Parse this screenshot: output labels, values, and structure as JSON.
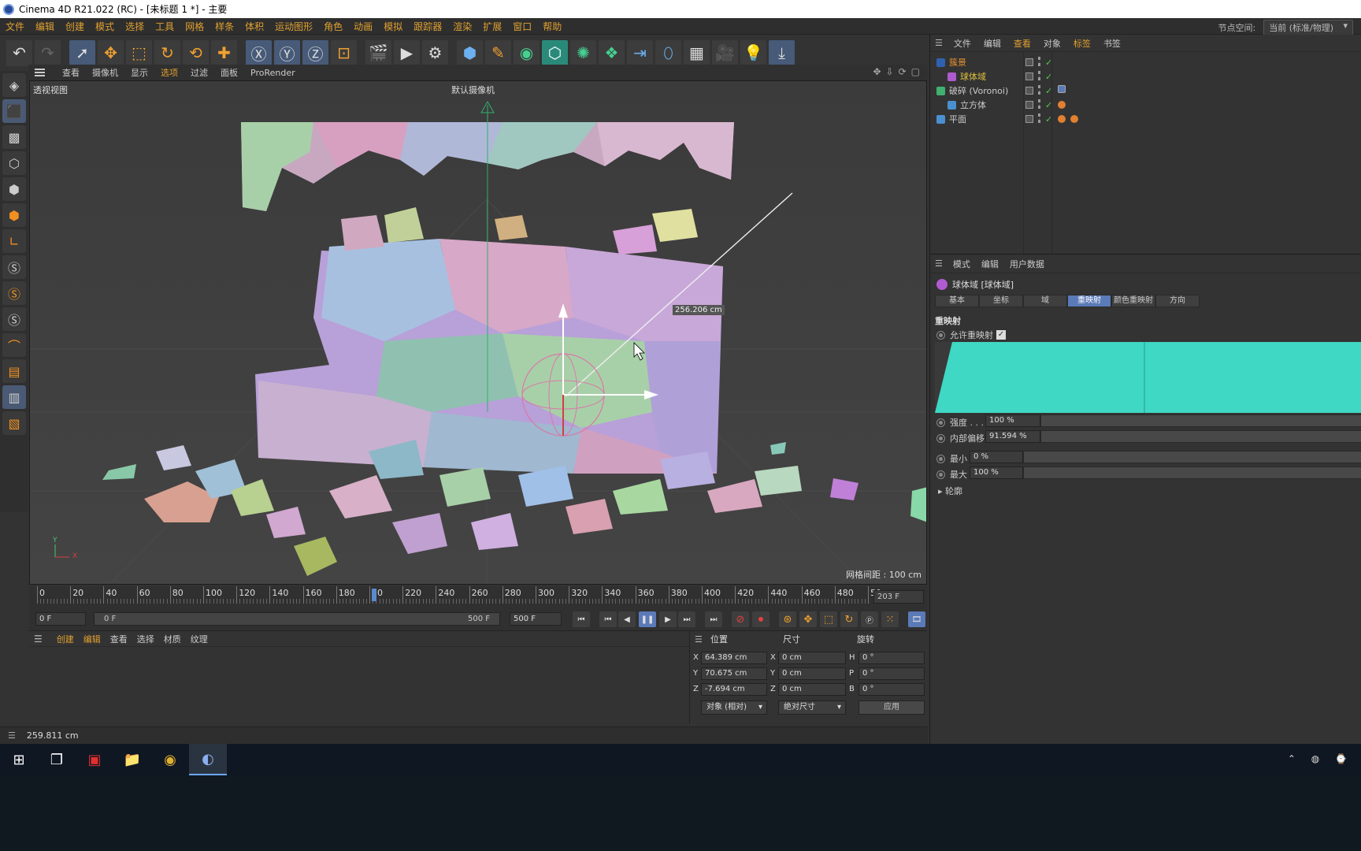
{
  "window": {
    "title": "Cinema 4D R21.022 (RC) - [未标题 1 *] - 主要"
  },
  "menubar": {
    "items": [
      "文件",
      "编辑",
      "创建",
      "模式",
      "选择",
      "工具",
      "网格",
      "样条",
      "体积",
      "运动图形",
      "角色",
      "动画",
      "模拟",
      "跟踪器",
      "渲染",
      "扩展",
      "窗口",
      "帮助"
    ],
    "node_space_label": "节点空间:",
    "node_space_value": "当前 (标准/物理)"
  },
  "viewport_menu": {
    "items": [
      "查看",
      "摄像机",
      "显示",
      "选项",
      "过滤",
      "面板",
      "ProRender"
    ],
    "highlight_index": 3
  },
  "viewport": {
    "view_name": "透视视图",
    "camera_name": "默认摄像机",
    "grid_spacing": "网格间距 : 100 cm",
    "dimension_readout": "256.206 cm",
    "axis_y": "Y",
    "axis_x": "X"
  },
  "timeline": {
    "ticks": [
      "0",
      "20",
      "40",
      "60",
      "80",
      "100",
      "120",
      "140",
      "160",
      "180",
      "20",
      "220",
      "240",
      "260",
      "280",
      "300",
      "320",
      "340",
      "360",
      "380",
      "400",
      "420",
      "440",
      "460",
      "480",
      "50"
    ],
    "current_frame": "203 F",
    "playhead_frame": 203
  },
  "transport": {
    "start_field": "0 F",
    "range_start": "0 F",
    "range_end": "500 F",
    "end_field": "500 F"
  },
  "material_panel": {
    "menu": [
      "创建",
      "编辑",
      "查看",
      "选择",
      "材质",
      "纹理"
    ]
  },
  "coordinates": {
    "headers": {
      "position": "位置",
      "size": "尺寸",
      "rotation": "旋转"
    },
    "rows": [
      {
        "axis": "X",
        "pos": "64.389 cm",
        "size_axis": "X",
        "size": "0 cm",
        "rot_axis": "H",
        "rot": "0 °"
      },
      {
        "axis": "Y",
        "pos": "70.675 cm",
        "size_axis": "Y",
        "size": "0 cm",
        "rot_axis": "P",
        "rot": "0 °"
      },
      {
        "axis": "Z",
        "pos": "-7.694 cm",
        "size_axis": "Z",
        "size": "0 cm",
        "rot_axis": "B",
        "rot": "0 °"
      }
    ],
    "mode_dropdown": "对象 (相对)",
    "size_dropdown": "绝对尺寸",
    "apply_label": "应用"
  },
  "status": {
    "text": "259.811 cm"
  },
  "object_manager": {
    "menu": [
      "文件",
      "编辑",
      "查看",
      "对象",
      "标签",
      "书签"
    ],
    "objects": [
      {
        "name": "簇景",
        "indent": 0,
        "color": "#e09030",
        "icon_color": "#3060b0"
      },
      {
        "name": "球体域",
        "indent": 1,
        "color": "#e0c040",
        "icon_color": "#b05ad0"
      },
      {
        "name": "破碎 (Voronoi)",
        "indent": 0,
        "color": "#cccccc",
        "icon_color": "#40b070"
      },
      {
        "name": "立方体",
        "indent": 1,
        "color": "#cccccc",
        "icon_color": "#4a90d0"
      },
      {
        "name": "平面",
        "indent": 0,
        "color": "#cccccc",
        "icon_color": "#4a90d0"
      }
    ]
  },
  "attributes": {
    "menu": [
      "模式",
      "编辑",
      "用户数据"
    ],
    "object_title": "球体域 [球体域]",
    "tabs": [
      "基本",
      "坐标",
      "域",
      "重映射",
      "颜色重映射",
      "方向"
    ],
    "active_tab": 3,
    "section": "重映射",
    "enable_remap_label": "允许重映射",
    "enable_remap_checked": true,
    "strength_label": "强度 . . .",
    "strength_value": "100 %",
    "inner_offset_label": "内部偏移",
    "inner_offset_value": "91.594 %",
    "min_label": "最小",
    "min_value": "0 %",
    "max_label": "最大",
    "max_value": "100 %",
    "contour_label": "轮廓",
    "curve_color": "#3fd8c4"
  },
  "colors": {
    "accent": "#e0a030",
    "active_tab": "#5a7ab8",
    "remap_curve": "#3fd8c4"
  }
}
